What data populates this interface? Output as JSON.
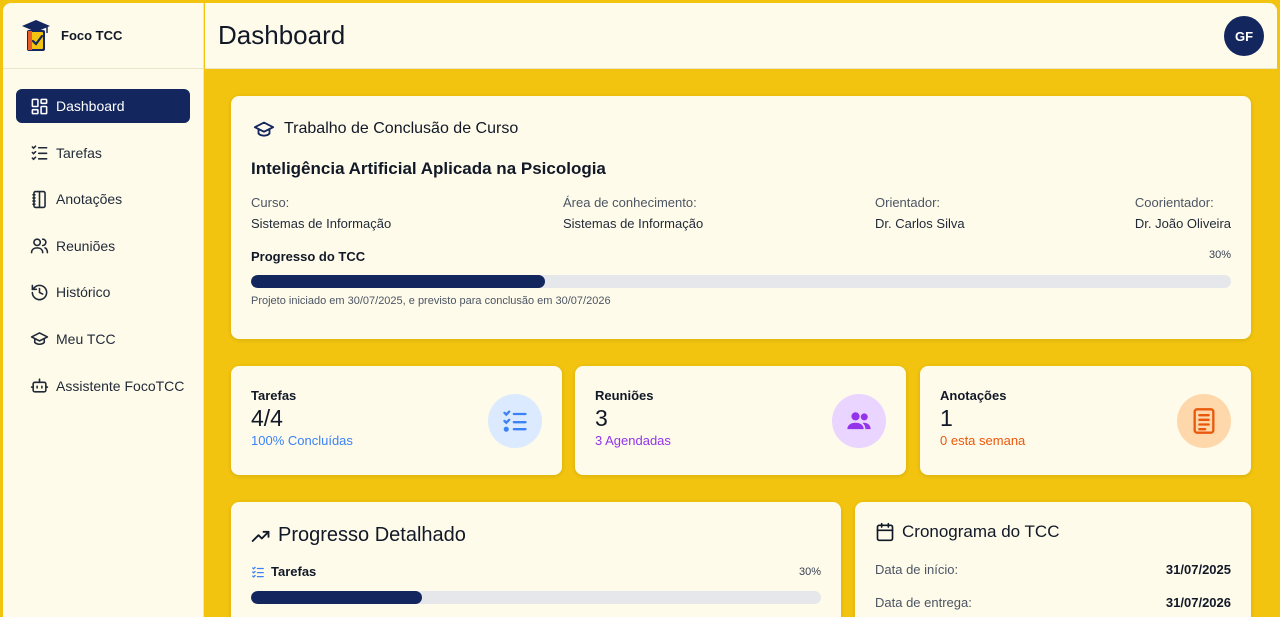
{
  "brand": {
    "name": "Foco TCC"
  },
  "header": {
    "title": "Dashboard",
    "avatar_initials": "GF"
  },
  "sidebar": {
    "items": [
      {
        "label": "Dashboard",
        "icon": "dashboard-icon",
        "active": true
      },
      {
        "label": "Tarefas",
        "icon": "checklist-icon"
      },
      {
        "label": "Anotações",
        "icon": "notebook-icon"
      },
      {
        "label": "Reuniões",
        "icon": "users-icon"
      },
      {
        "label": "Histórico",
        "icon": "history-icon"
      },
      {
        "label": "Meu TCC",
        "icon": "graduation-cap-icon"
      },
      {
        "label": "Assistente FocoTCC",
        "icon": "bot-icon"
      }
    ]
  },
  "tcc": {
    "section_title": "Trabalho de Conclusão de Curso",
    "title": "Inteligência Artificial Aplicada na Psicologia",
    "meta": [
      {
        "label": "Curso:",
        "value": "Sistemas de Informação"
      },
      {
        "label": "Área de conhecimento:",
        "value": "Sistemas de Informação"
      },
      {
        "label": "Orientador:",
        "value": "Dr. Carlos Silva"
      },
      {
        "label": "Coorientador:",
        "value": "Dr. João Oliveira"
      }
    ],
    "progress_label": "Progresso do TCC",
    "progress_pct_text": "30%",
    "progress_value": 0.3,
    "progress_note": "Projeto iniciado em 30/07/2025, e previsto para conclusão em 30/07/2026"
  },
  "stats": [
    {
      "title": "Tarefas",
      "value": "4/4",
      "sub": "100% Concluídas",
      "sub_color": "#3b82f6",
      "icon": "checklist-icon",
      "icon_bg": "#dbeafe",
      "icon_color": "#3b82f6"
    },
    {
      "title": "Reuniões",
      "value": "3",
      "sub": "3 Agendadas",
      "sub_color": "#9333ea",
      "icon": "users-icon",
      "icon_bg": "#e9d5ff",
      "icon_color": "#9333ea"
    },
    {
      "title": "Anotações",
      "value": "1",
      "sub": "0 esta semana",
      "sub_color": "#ea580c",
      "icon": "note-icon",
      "icon_bg": "#fed7aa",
      "icon_color": "#ea580c"
    }
  ],
  "detail": {
    "title": "Progresso Detalhado",
    "rows": [
      {
        "label": "Tarefas",
        "pct_text": "30%",
        "value": 0.3
      }
    ]
  },
  "crono": {
    "title": "Cronograma do TCC",
    "rows": [
      {
        "label": "Data de início:",
        "value": "31/07/2025"
      },
      {
        "label": "Data de entrega:",
        "value": "31/07/2026"
      }
    ]
  },
  "colors": {
    "accent": "#13275e",
    "background": "#f2c40f",
    "surface": "#fffbea"
  }
}
